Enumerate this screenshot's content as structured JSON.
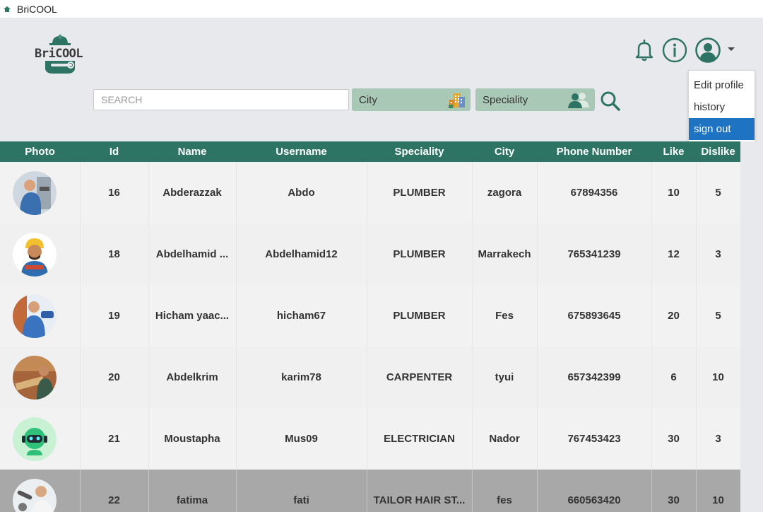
{
  "window": {
    "title": "BriCOOL"
  },
  "logo": {
    "text": "BriCOOL"
  },
  "search": {
    "placeholder": "SEARCH",
    "value": ""
  },
  "filters": {
    "city": "City",
    "speciality": "Speciality"
  },
  "user_menu": {
    "items": [
      "Edit profile",
      "history",
      "sign out"
    ],
    "active_index": 2
  },
  "table": {
    "columns": [
      "Photo",
      "Id",
      "Name",
      "Username",
      "Speciality",
      "City",
      "Phone Number",
      "Like",
      "Dislike"
    ],
    "rows": [
      {
        "id": "16",
        "name": "Abderazzak",
        "username": "Abdo",
        "speciality": "PLUMBER",
        "city": "zagora",
        "phone": "67894356",
        "like": "10",
        "dislike": "5"
      },
      {
        "id": "18",
        "name": "Abdelhamid ...",
        "username": "Abdelhamid12",
        "speciality": "PLUMBER",
        "city": "Marrakech",
        "phone": "765341239",
        "like": "12",
        "dislike": "3"
      },
      {
        "id": "19",
        "name": "Hicham yaac...",
        "username": "hicham67",
        "speciality": "PLUMBER",
        "city": "Fes",
        "phone": "675893645",
        "like": "20",
        "dislike": "5"
      },
      {
        "id": "20",
        "name": "Abdelkrim",
        "username": "karim78",
        "speciality": "CARPENTER",
        "city": "tyui",
        "phone": "657342399",
        "like": "6",
        "dislike": "10"
      },
      {
        "id": "21",
        "name": "Moustapha",
        "username": "Mus09",
        "speciality": "ELECTRICIAN",
        "city": "Nador",
        "phone": "767453423",
        "like": "30",
        "dislike": "3"
      },
      {
        "id": "22",
        "name": "fatima",
        "username": "fati",
        "speciality": "TAILOR HAIR ST...",
        "city": "fes",
        "phone": "660563420",
        "like": "30",
        "dislike": "10"
      }
    ],
    "selected_index": 5
  },
  "colors": {
    "header_bg": "#2e7465",
    "filter_bg": "#a9c8b6",
    "brand_teal": "#2e7465",
    "menu_active": "#1e73c3"
  },
  "icons": [
    "app-icon",
    "bell-icon",
    "info-icon",
    "user-avatar-icon",
    "caret-down-icon",
    "search-icon",
    "city-buildings-icon",
    "people-icon"
  ]
}
